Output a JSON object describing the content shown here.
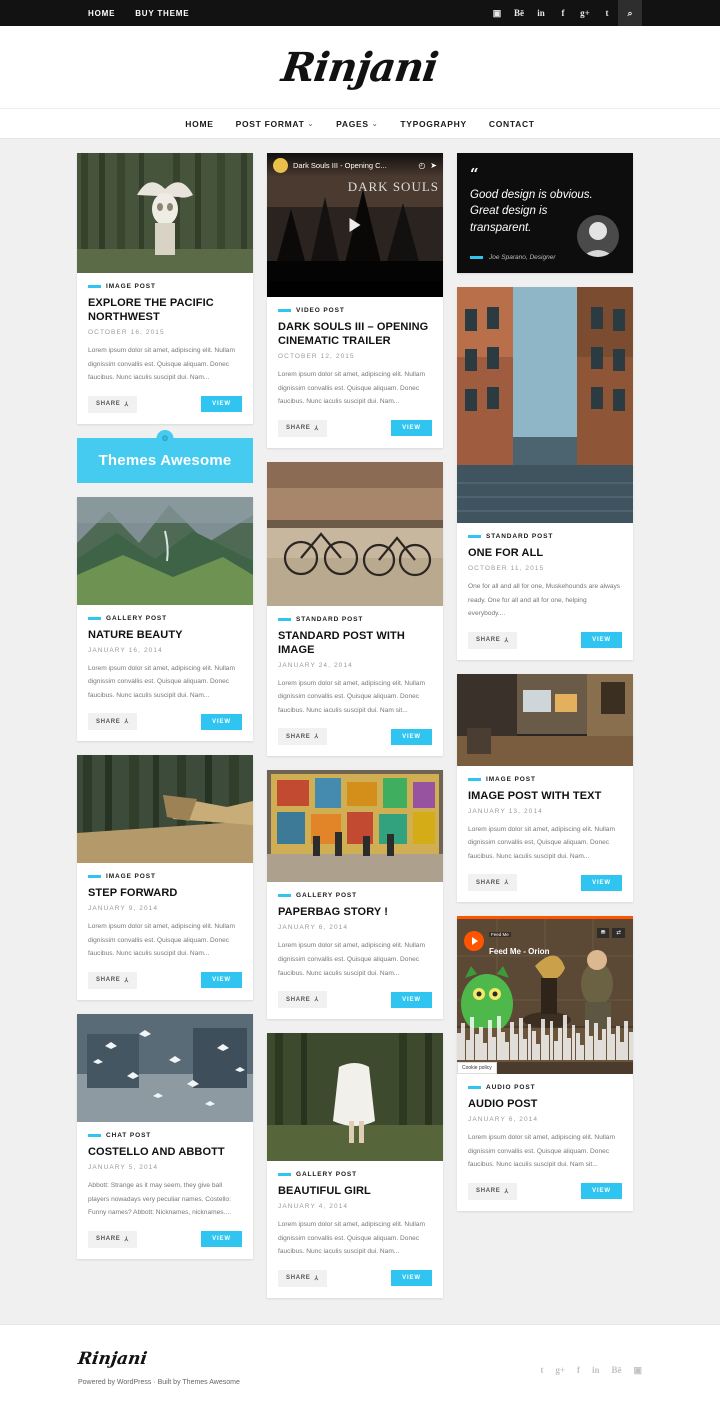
{
  "topbar": {
    "nav": [
      {
        "label": "HOME"
      },
      {
        "label": "BUY THEME"
      }
    ],
    "social": [
      {
        "name": "instagram-icon",
        "glyph": "▣"
      },
      {
        "name": "behance-icon",
        "glyph": "Bē"
      },
      {
        "name": "linkedin-icon",
        "glyph": "in"
      },
      {
        "name": "facebook-icon",
        "glyph": "f"
      },
      {
        "name": "google-plus-icon",
        "glyph": "g+"
      },
      {
        "name": "twitter-icon",
        "glyph": "t"
      },
      {
        "name": "search-icon",
        "glyph": "⌕"
      }
    ]
  },
  "site": {
    "logo": "Rinjani"
  },
  "mainnav": [
    {
      "label": "HOME",
      "caret": ""
    },
    {
      "label": "POST FORMAT",
      "caret": "⌄"
    },
    {
      "label": "PAGES",
      "caret": "⌄"
    },
    {
      "label": "TYPOGRAPHY",
      "caret": ""
    },
    {
      "label": "CONTACT",
      "caret": ""
    }
  ],
  "labels": {
    "share": "SHARE",
    "share_icon": "⅄",
    "view": "VIEW"
  },
  "banner": {
    "text": "Themes Awesome",
    "icon": "⚙",
    "color": "#45caf0"
  },
  "quote": {
    "mark": "“",
    "text": "Good design is obvious. Great design is transparent.",
    "author": "Joe Sparano, Designer",
    "accent": "#2fc5f0"
  },
  "video_embed": {
    "provider": "youtube",
    "title": "Dark Souls III - Opening C...",
    "watermark": "DARK SOULS",
    "clock_icon": "◴",
    "share_icon": "➤"
  },
  "audio_embed": {
    "provider": "soundcloud",
    "small_label": "Feed Me",
    "track": "Feed Me - Orion",
    "cookie_notice": "Cookie policy",
    "buy_icon": "⛃",
    "share_icon": "⇄",
    "accent": "#ff5500"
  },
  "columns": [
    {
      "id": "left",
      "cards": [
        {
          "type": "post",
          "name": "post-explore-the-pacific-northwest",
          "media": "photo-skull-antlers-forest",
          "category": "IMAGE POST",
          "title": "EXPLORE THE PACIFIC NORTHWEST",
          "date": "OCTOBER 16, 2015",
          "excerpt": "Lorem ipsum dolor sit amet,  adipiscing elit. Nullam dignissim convallis est. Quisque aliquam. Donec faucibus. Nunc iaculis suscipit dui. Nam..."
        },
        {
          "type": "banner",
          "name": "themes-awesome-banner"
        },
        {
          "type": "post",
          "name": "post-nature-beauty",
          "media": "photo-green-mountain-valley",
          "category": "GALLERY POST",
          "title": "NATURE BEAUTY",
          "date": "JANUARY 16, 2014",
          "excerpt": "Lorem ipsum dolor sit amet,  adipiscing elit. Nullam dignissim convallis est. Quisque aliquam. Donec faucibus. Nunc iaculis suscipit dui. Nam..."
        },
        {
          "type": "post",
          "name": "post-step-forward",
          "media": "photo-forest-wooden-platform",
          "category": "IMAGE POST",
          "title": "STEP FORWARD",
          "date": "JANUARY 9, 2014",
          "excerpt": "Lorem ipsum dolor sit amet,  adipiscing elit. Nullam dignissim convallis est. Quisque aliquam. Donec faucibus. Nunc iaculis suscipit dui. Nam..."
        },
        {
          "type": "post",
          "name": "post-costello-and-abbott",
          "media": "photo-birds-flying-ruins",
          "category": "CHAT POST",
          "title": "COSTELLO AND ABBOTT",
          "date": "JANUARY 5, 2014",
          "excerpt": "Abbott: Strange as it may seem, they give ball players nowadays very peculiar names. Costello: Funny names? Abbott: Nicknames, nicknames...."
        }
      ]
    },
    {
      "id": "middle",
      "cards": [
        {
          "type": "video",
          "name": "post-dark-souls-iii-opening-cinematic-trailer",
          "category": "VIDEO POST",
          "title": "DARK SOULS III – OPENING CINEMATIC TRAILER",
          "date": "OCTOBER 12, 2015",
          "excerpt": "Lorem ipsum dolor sit amet,  adipiscing elit. Nullam dignissim convallis est. Quisque aliquam. Donec faucibus. Nunc iaculis suscipit dui. Nam..."
        },
        {
          "type": "post",
          "name": "post-standard-post-with-image",
          "media": "photo-vintage-bicycles-street",
          "category": "STANDARD POST",
          "title": "STANDARD POST WITH IMAGE",
          "date": "JANUARY 24, 2014",
          "excerpt": "Lorem ipsum dolor sit amet, adipiscing elit. Nullam dignissim convallis est. Quisque aliquam. Donec faucibus. Nunc iaculis suscipit dui. Nam sit..."
        },
        {
          "type": "post",
          "name": "post-paperbag-story",
          "media": "photo-graffiti-wall-people",
          "category": "GALLERY POST",
          "title": "PAPERBAG STORY !",
          "date": "JANUARY 6, 2014",
          "excerpt": "Lorem ipsum dolor sit amet,  adipiscing elit. Nullam dignissim convallis est. Quisque aliquam. Donec faucibus. Nunc iaculis suscipit dui. Nam..."
        },
        {
          "type": "post",
          "name": "post-beautiful-girl",
          "media": "photo-girl-white-dress-forest",
          "category": "GALLERY POST",
          "title": "BEAUTIFUL GIRL",
          "date": "JANUARY 4, 2014",
          "excerpt": "Lorem ipsum dolor sit amet,  adipiscing elit. Nullam dignissim convallis est. Quisque aliquam. Donec faucibus. Nunc iaculis suscipit dui. Nam..."
        }
      ]
    },
    {
      "id": "right",
      "cards": [
        {
          "type": "quote",
          "name": "quote-card"
        },
        {
          "type": "post",
          "name": "post-one-for-all",
          "media": "photo-narrow-city-street",
          "category": "STANDARD POST",
          "title": "ONE FOR ALL",
          "date": "OCTOBER 11, 2015",
          "excerpt": "One for all and all for one, Muskehounds are always ready. One for all and all for one, helping everybody...."
        },
        {
          "type": "post",
          "name": "post-image-post-with-text",
          "media": "photo-interior-room-desk",
          "category": "IMAGE POST",
          "title": "IMAGE POST WITH TEXT",
          "date": "JANUARY 13, 2014",
          "excerpt": "Lorem ipsum dolor sit amet,  adipiscing elit. Nullam dignissim convallis est, Quisque aliquam. Donec faucibus. Nunc iaculis suscipit dui. Nam..."
        },
        {
          "type": "audio",
          "name": "post-audio-post",
          "category": "AUDIO POST",
          "title": "AUDIO POST",
          "date": "JANUARY 6, 2014",
          "excerpt": "Lorem ipsum dolor sit amet, adipiscing elit. Nullam dignissim convallis est. Quisque aliquam. Donec faucibus. Nunc iaculis suscipit dui. Nam sit..."
        }
      ]
    }
  ],
  "footer": {
    "logo": "Rinjani",
    "credit": "Powered by WordPress · Built by Themes Awesome",
    "social": [
      {
        "name": "twitter-icon",
        "glyph": "t"
      },
      {
        "name": "google-plus-icon",
        "glyph": "g+"
      },
      {
        "name": "facebook-icon",
        "glyph": "f"
      },
      {
        "name": "linkedin-icon",
        "glyph": "in"
      },
      {
        "name": "behance-icon",
        "glyph": "Bē"
      },
      {
        "name": "instagram-icon",
        "glyph": "▣"
      }
    ]
  }
}
